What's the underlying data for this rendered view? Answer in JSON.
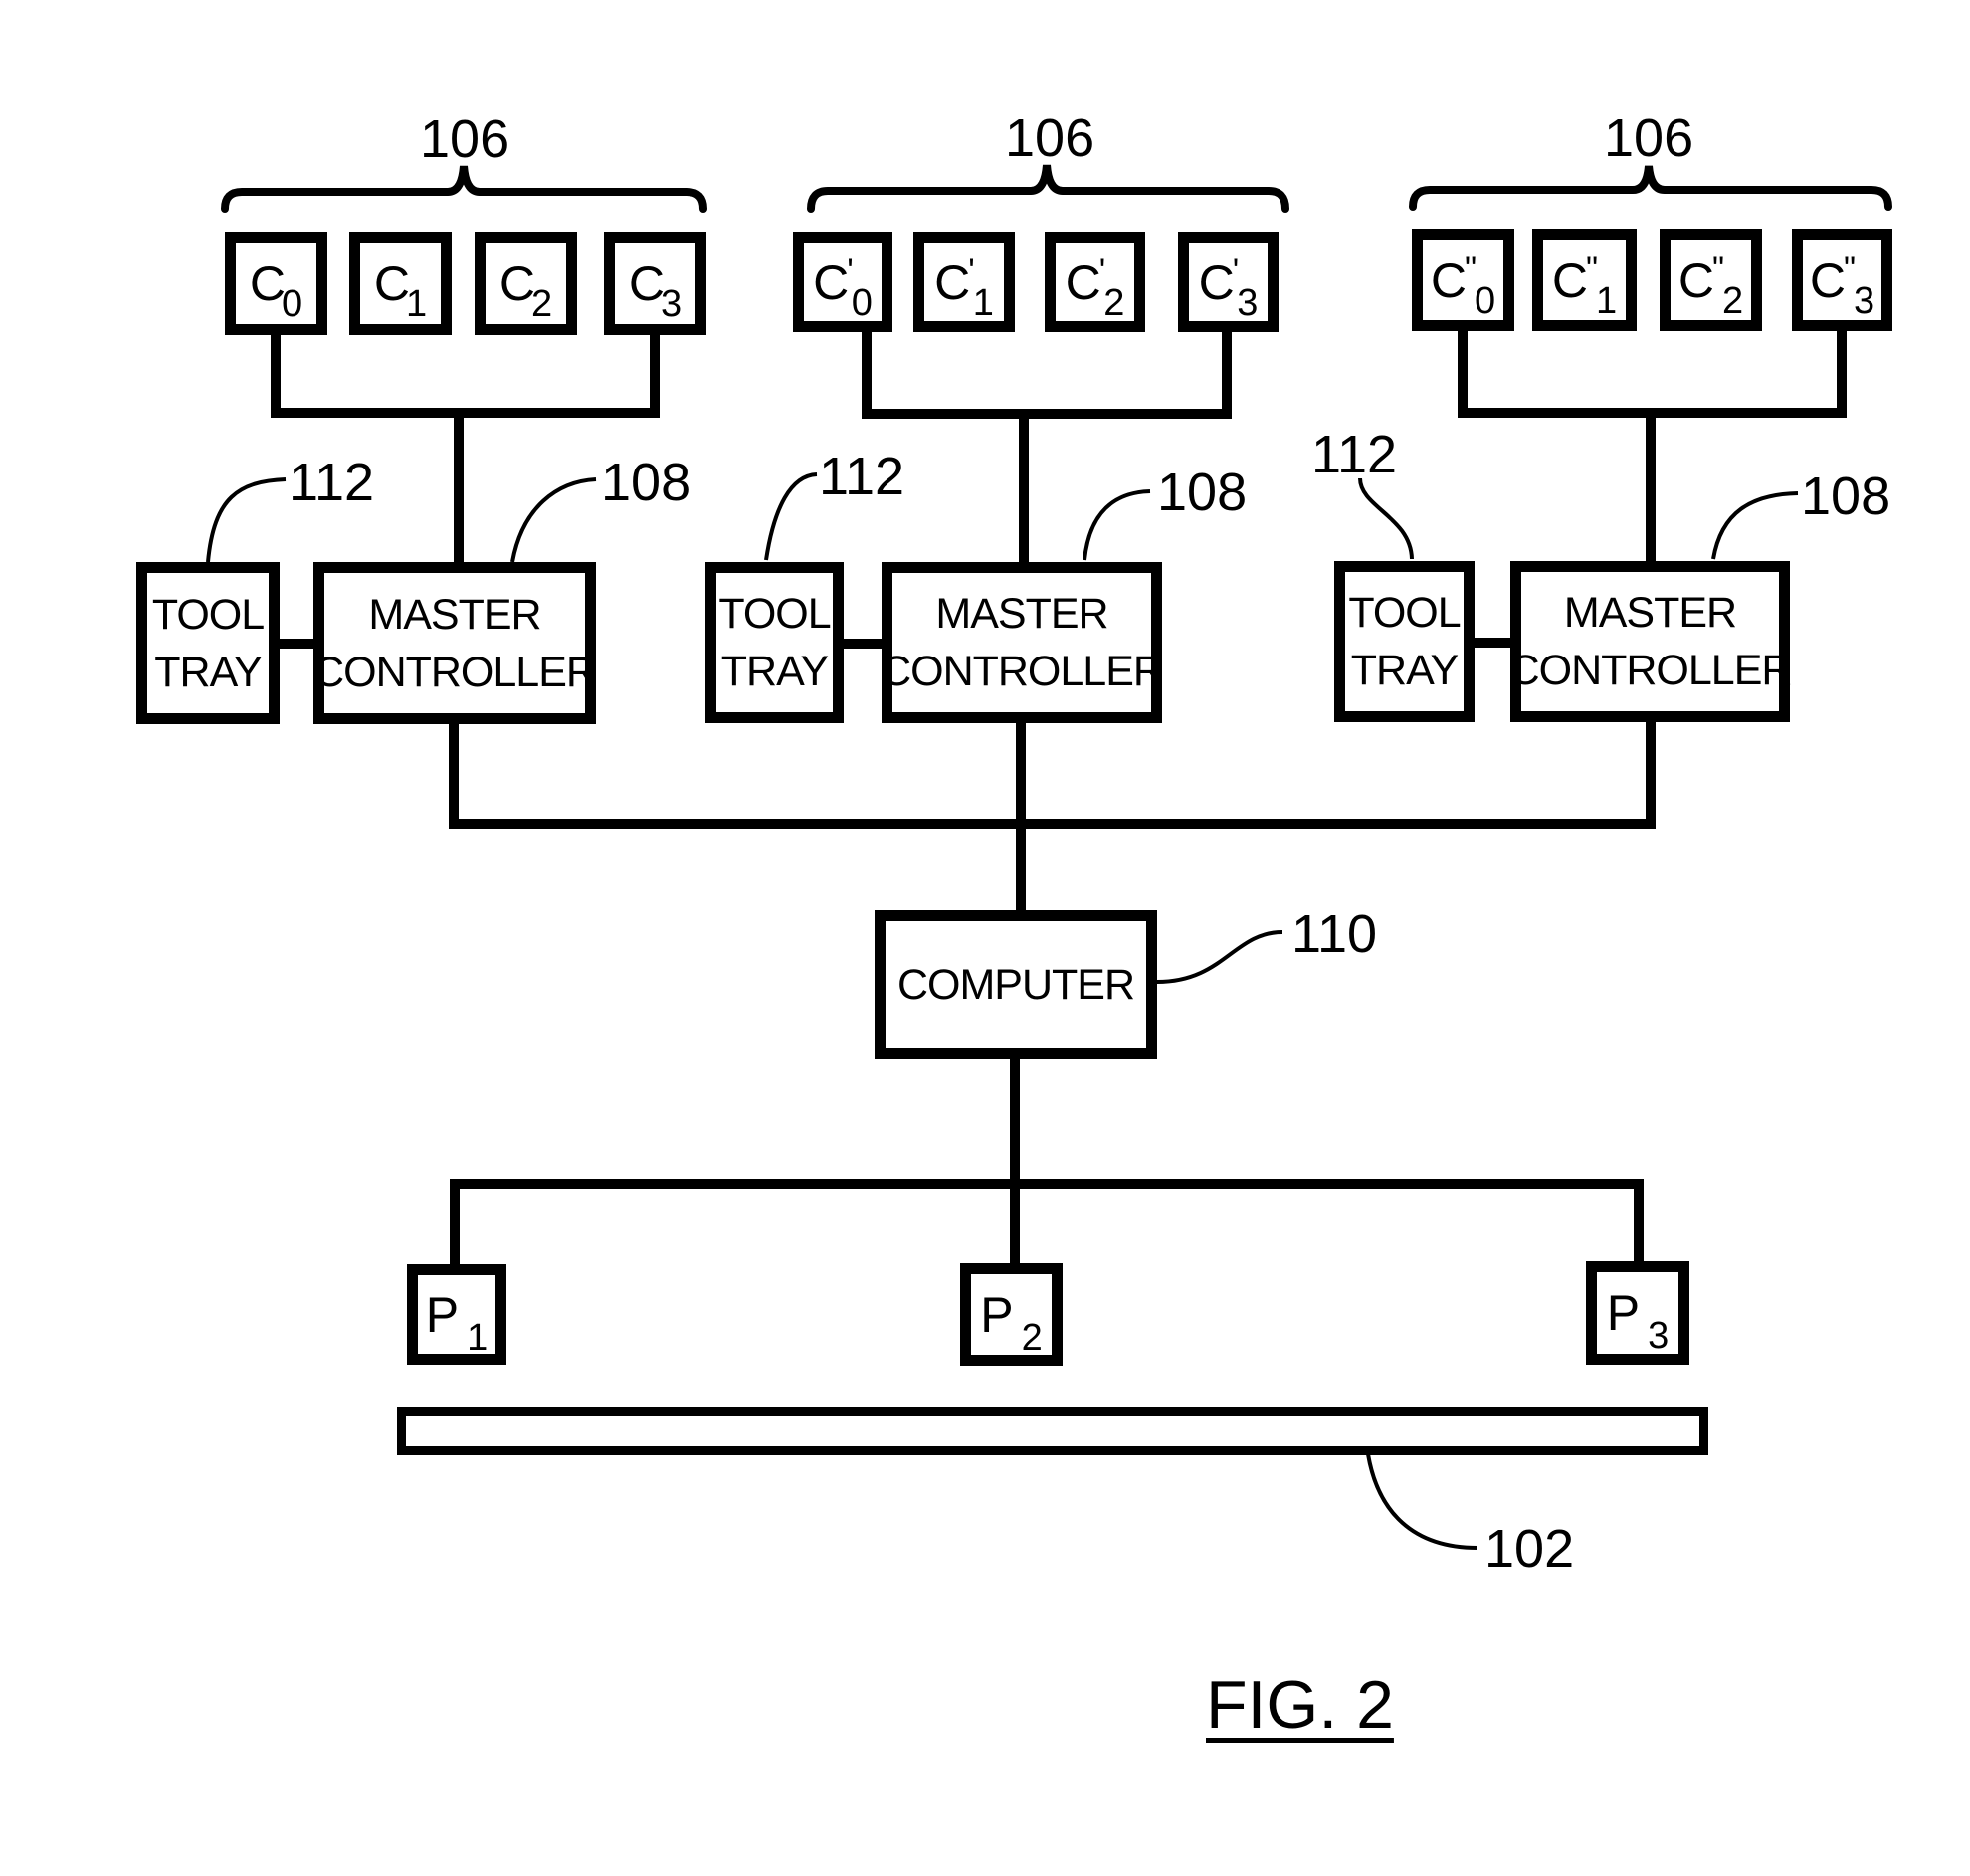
{
  "figure": {
    "title": "FIG. 2",
    "groups": [
      {
        "ref_cameras": "106",
        "cameras": [
          {
            "base": "C",
            "prime": "",
            "sub": "0"
          },
          {
            "base": "C",
            "prime": "",
            "sub": "1"
          },
          {
            "base": "C",
            "prime": "",
            "sub": "2"
          },
          {
            "base": "C",
            "prime": "",
            "sub": "3"
          }
        ],
        "tool_tray": {
          "line1": "TOOL",
          "line2": "TRAY",
          "ref": "112"
        },
        "master_controller": {
          "line1": "MASTER",
          "line2": "CONTROLLER",
          "ref": "108"
        }
      },
      {
        "ref_cameras": "106",
        "cameras": [
          {
            "base": "C",
            "prime": "'",
            "sub": "0"
          },
          {
            "base": "C",
            "prime": "'",
            "sub": "1"
          },
          {
            "base": "C",
            "prime": "'",
            "sub": "2"
          },
          {
            "base": "C",
            "prime": "'",
            "sub": "3"
          }
        ],
        "tool_tray": {
          "line1": "TOOL",
          "line2": "TRAY",
          "ref": "112"
        },
        "master_controller": {
          "line1": "MASTER",
          "line2": "CONTROLLER",
          "ref": "108"
        }
      },
      {
        "ref_cameras": "106",
        "cameras": [
          {
            "base": "C",
            "prime": "\"",
            "sub": "0"
          },
          {
            "base": "C",
            "prime": "\"",
            "sub": "1"
          },
          {
            "base": "C",
            "prime": "\"",
            "sub": "2"
          },
          {
            "base": "C",
            "prime": "\"",
            "sub": "3"
          }
        ],
        "tool_tray": {
          "line1": "TOOL",
          "line2": "TRAY",
          "ref": "112"
        },
        "master_controller": {
          "line1": "MASTER",
          "line2": "CONTROLLER",
          "ref": "108"
        }
      }
    ],
    "computer": {
      "label": "COMPUTER",
      "ref": "110"
    },
    "projectors": [
      {
        "base": "P",
        "sub": "1"
      },
      {
        "base": "P",
        "sub": "2"
      },
      {
        "base": "P",
        "sub": "3"
      }
    ],
    "surface": {
      "ref": "102"
    }
  }
}
